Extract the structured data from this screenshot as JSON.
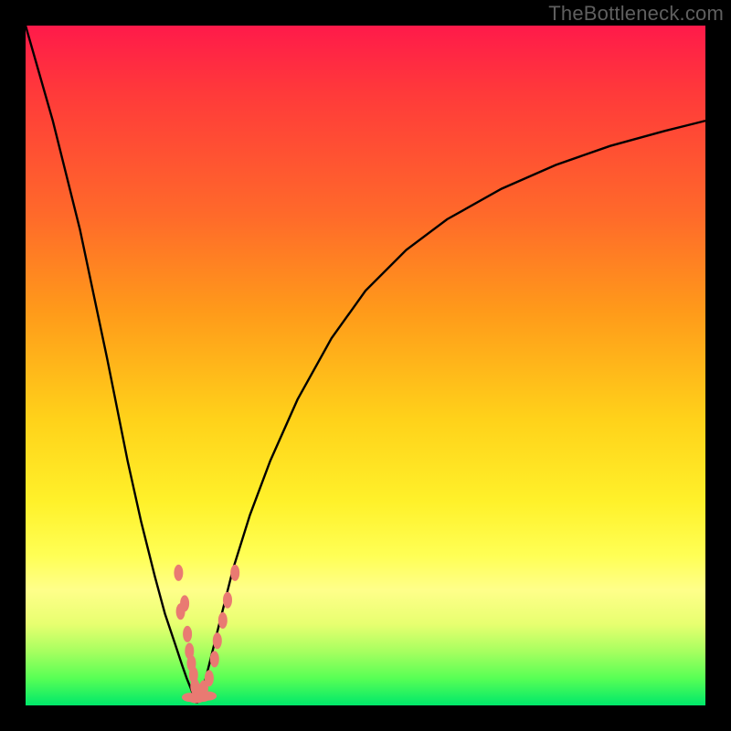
{
  "watermark": "TheBottleneck.com",
  "chart_data": {
    "type": "line",
    "title": "",
    "xlabel": "",
    "ylabel": "",
    "xlim": [
      0,
      100
    ],
    "ylim": [
      0,
      100
    ],
    "grid": false,
    "curves": {
      "left": {
        "x": [
          0,
          4,
          8,
          12,
          15,
          17,
          19,
          20.5,
          22,
          23,
          23.7,
          24.3,
          24.8,
          25.2
        ],
        "y": [
          100,
          86,
          70,
          51,
          36,
          27,
          19,
          13.5,
          9,
          6,
          4,
          2.5,
          1.2,
          0.3
        ]
      },
      "right": {
        "x": [
          25.2,
          26,
          27,
          28.5,
          30.5,
          33,
          36,
          40,
          45,
          50,
          56,
          62,
          70,
          78,
          86,
          94,
          100
        ],
        "y": [
          0.3,
          2,
          6,
          12,
          20,
          28,
          36,
          45,
          54,
          61,
          67,
          71.5,
          76,
          79.5,
          82.3,
          84.5,
          86
        ]
      }
    },
    "markers_left": [
      [
        22.5,
        19.5
      ],
      [
        23.4,
        15
      ],
      [
        22.8,
        13.8
      ],
      [
        23.8,
        10.5
      ],
      [
        24.1,
        8
      ],
      [
        24.4,
        6.2
      ],
      [
        24.7,
        4.5
      ],
      [
        24.9,
        2.8
      ]
    ],
    "markers_right": [
      [
        25.5,
        2.0
      ],
      [
        26.2,
        2.5
      ],
      [
        27.0,
        4.0
      ],
      [
        27.8,
        6.8
      ],
      [
        28.2,
        9.5
      ],
      [
        29.0,
        12.5
      ],
      [
        29.7,
        15.5
      ],
      [
        30.8,
        19.5
      ]
    ],
    "markers_bottom": [
      [
        24.2,
        1.2
      ],
      [
        25.1,
        1.0
      ],
      [
        26.0,
        1.2
      ],
      [
        26.9,
        1.4
      ]
    ],
    "marker_style": {
      "rx": 5,
      "ry": 9,
      "fill": "#e97a72"
    },
    "colors": {
      "bg_top": "#ff1a4a",
      "bg_bottom": "#00e86a",
      "curve": "#000000",
      "frame": "#000000"
    }
  }
}
